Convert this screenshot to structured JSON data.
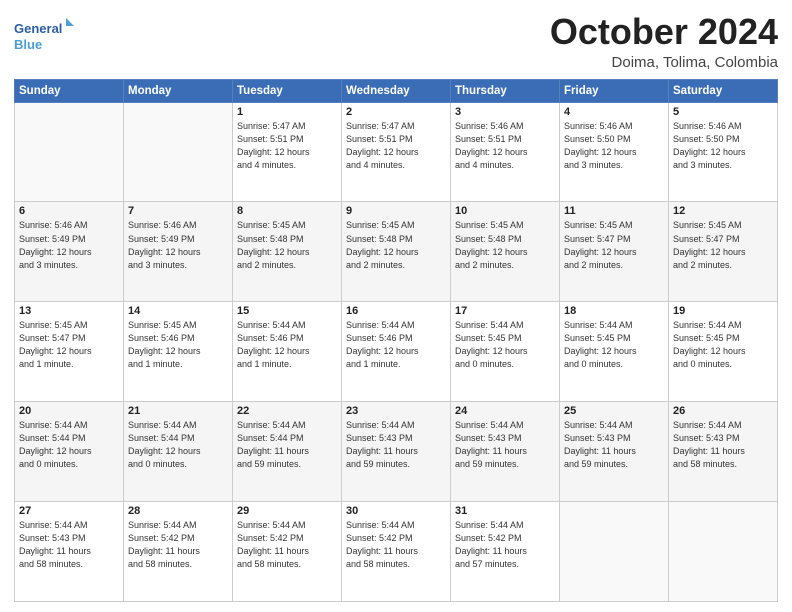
{
  "logo": {
    "line1": "General",
    "line2": "Blue"
  },
  "title": "October 2024",
  "location": "Doima, Tolima, Colombia",
  "days_of_week": [
    "Sunday",
    "Monday",
    "Tuesday",
    "Wednesday",
    "Thursday",
    "Friday",
    "Saturday"
  ],
  "weeks": [
    [
      {
        "day": "",
        "detail": ""
      },
      {
        "day": "",
        "detail": ""
      },
      {
        "day": "1",
        "detail": "Sunrise: 5:47 AM\nSunset: 5:51 PM\nDaylight: 12 hours\nand 4 minutes."
      },
      {
        "day": "2",
        "detail": "Sunrise: 5:47 AM\nSunset: 5:51 PM\nDaylight: 12 hours\nand 4 minutes."
      },
      {
        "day": "3",
        "detail": "Sunrise: 5:46 AM\nSunset: 5:51 PM\nDaylight: 12 hours\nand 4 minutes."
      },
      {
        "day": "4",
        "detail": "Sunrise: 5:46 AM\nSunset: 5:50 PM\nDaylight: 12 hours\nand 3 minutes."
      },
      {
        "day": "5",
        "detail": "Sunrise: 5:46 AM\nSunset: 5:50 PM\nDaylight: 12 hours\nand 3 minutes."
      }
    ],
    [
      {
        "day": "6",
        "detail": "Sunrise: 5:46 AM\nSunset: 5:49 PM\nDaylight: 12 hours\nand 3 minutes."
      },
      {
        "day": "7",
        "detail": "Sunrise: 5:46 AM\nSunset: 5:49 PM\nDaylight: 12 hours\nand 3 minutes."
      },
      {
        "day": "8",
        "detail": "Sunrise: 5:45 AM\nSunset: 5:48 PM\nDaylight: 12 hours\nand 2 minutes."
      },
      {
        "day": "9",
        "detail": "Sunrise: 5:45 AM\nSunset: 5:48 PM\nDaylight: 12 hours\nand 2 minutes."
      },
      {
        "day": "10",
        "detail": "Sunrise: 5:45 AM\nSunset: 5:48 PM\nDaylight: 12 hours\nand 2 minutes."
      },
      {
        "day": "11",
        "detail": "Sunrise: 5:45 AM\nSunset: 5:47 PM\nDaylight: 12 hours\nand 2 minutes."
      },
      {
        "day": "12",
        "detail": "Sunrise: 5:45 AM\nSunset: 5:47 PM\nDaylight: 12 hours\nand 2 minutes."
      }
    ],
    [
      {
        "day": "13",
        "detail": "Sunrise: 5:45 AM\nSunset: 5:47 PM\nDaylight: 12 hours\nand 1 minute."
      },
      {
        "day": "14",
        "detail": "Sunrise: 5:45 AM\nSunset: 5:46 PM\nDaylight: 12 hours\nand 1 minute."
      },
      {
        "day": "15",
        "detail": "Sunrise: 5:44 AM\nSunset: 5:46 PM\nDaylight: 12 hours\nand 1 minute."
      },
      {
        "day": "16",
        "detail": "Sunrise: 5:44 AM\nSunset: 5:46 PM\nDaylight: 12 hours\nand 1 minute."
      },
      {
        "day": "17",
        "detail": "Sunrise: 5:44 AM\nSunset: 5:45 PM\nDaylight: 12 hours\nand 0 minutes."
      },
      {
        "day": "18",
        "detail": "Sunrise: 5:44 AM\nSunset: 5:45 PM\nDaylight: 12 hours\nand 0 minutes."
      },
      {
        "day": "19",
        "detail": "Sunrise: 5:44 AM\nSunset: 5:45 PM\nDaylight: 12 hours\nand 0 minutes."
      }
    ],
    [
      {
        "day": "20",
        "detail": "Sunrise: 5:44 AM\nSunset: 5:44 PM\nDaylight: 12 hours\nand 0 minutes."
      },
      {
        "day": "21",
        "detail": "Sunrise: 5:44 AM\nSunset: 5:44 PM\nDaylight: 12 hours\nand 0 minutes."
      },
      {
        "day": "22",
        "detail": "Sunrise: 5:44 AM\nSunset: 5:44 PM\nDaylight: 11 hours\nand 59 minutes."
      },
      {
        "day": "23",
        "detail": "Sunrise: 5:44 AM\nSunset: 5:43 PM\nDaylight: 11 hours\nand 59 minutes."
      },
      {
        "day": "24",
        "detail": "Sunrise: 5:44 AM\nSunset: 5:43 PM\nDaylight: 11 hours\nand 59 minutes."
      },
      {
        "day": "25",
        "detail": "Sunrise: 5:44 AM\nSunset: 5:43 PM\nDaylight: 11 hours\nand 59 minutes."
      },
      {
        "day": "26",
        "detail": "Sunrise: 5:44 AM\nSunset: 5:43 PM\nDaylight: 11 hours\nand 58 minutes."
      }
    ],
    [
      {
        "day": "27",
        "detail": "Sunrise: 5:44 AM\nSunset: 5:43 PM\nDaylight: 11 hours\nand 58 minutes."
      },
      {
        "day": "28",
        "detail": "Sunrise: 5:44 AM\nSunset: 5:42 PM\nDaylight: 11 hours\nand 58 minutes."
      },
      {
        "day": "29",
        "detail": "Sunrise: 5:44 AM\nSunset: 5:42 PM\nDaylight: 11 hours\nand 58 minutes."
      },
      {
        "day": "30",
        "detail": "Sunrise: 5:44 AM\nSunset: 5:42 PM\nDaylight: 11 hours\nand 58 minutes."
      },
      {
        "day": "31",
        "detail": "Sunrise: 5:44 AM\nSunset: 5:42 PM\nDaylight: 11 hours\nand 57 minutes."
      },
      {
        "day": "",
        "detail": ""
      },
      {
        "day": "",
        "detail": ""
      }
    ]
  ]
}
